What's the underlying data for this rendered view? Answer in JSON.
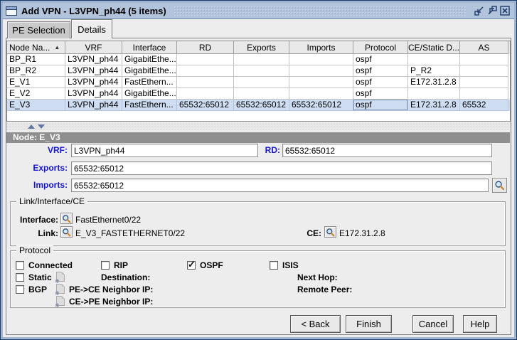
{
  "window": {
    "title": "Add VPN - L3VPN_ph44 (5 items)"
  },
  "tabs": {
    "pe_selection": "PE Selection",
    "details": "Details"
  },
  "table": {
    "headers": {
      "node": "Node Na...",
      "vrf": "VRF",
      "interface": "Interface",
      "rd": "RD",
      "exports": "Exports",
      "imports": "Imports",
      "protocol": "Protocol",
      "ce": "CE/Static D...",
      "as": "AS"
    },
    "sort_indicator": "▲",
    "rows": [
      {
        "node": "BP_R1",
        "vrf": "L3VPN_ph44",
        "interface": "GigabitEthe...",
        "rd": "",
        "exports": "",
        "imports": "",
        "protocol": "ospf",
        "ce": "",
        "as": ""
      },
      {
        "node": "BP_R2",
        "vrf": "L3VPN_ph44",
        "interface": "GigabitEthe...",
        "rd": "",
        "exports": "",
        "imports": "",
        "protocol": "ospf",
        "ce": "P_R2",
        "as": ""
      },
      {
        "node": "E_V1",
        "vrf": "L3VPN_ph44",
        "interface": "FastEthern...",
        "rd": "",
        "exports": "",
        "imports": "",
        "protocol": "ospf",
        "ce": "E172.31.2.8",
        "as": ""
      },
      {
        "node": "E_V2",
        "vrf": "L3VPN_ph44",
        "interface": "GigabitEthe...",
        "rd": "",
        "exports": "",
        "imports": "",
        "protocol": "ospf",
        "ce": "",
        "as": ""
      },
      {
        "node": "E_V3",
        "vrf": "L3VPN_ph44",
        "interface": "FastEthern...",
        "rd": "65532:65012",
        "exports": "65532:65012",
        "imports": "65532:65012",
        "protocol": "ospf",
        "ce": "E172.31.2.8",
        "as": "65532"
      }
    ]
  },
  "details": {
    "node_header": "Node: E_V3",
    "vrf": {
      "label": "VRF:",
      "value": "L3VPN_ph44"
    },
    "rd": {
      "label": "RD:",
      "value": "65532:65012"
    },
    "exports": {
      "label": "Exports:",
      "value": "65532:65012"
    },
    "imports": {
      "label": "Imports:",
      "value": "65532:65012"
    },
    "link_group": {
      "title": "Link/Interface/CE",
      "interface": {
        "label": "Interface:",
        "value": "FastEthernet0/22"
      },
      "link": {
        "label": "Link:",
        "value": "E_V3_FASTETHERNET0/22"
      },
      "ce": {
        "label": "CE:",
        "value": "E172.31.2.8"
      }
    },
    "protocol_group": {
      "title": "Protocol",
      "connected": {
        "label": "Connected",
        "checked": false
      },
      "rip": {
        "label": "RIP",
        "checked": false
      },
      "ospf": {
        "label": "OSPF",
        "checked": true
      },
      "isis": {
        "label": "ISIS",
        "checked": false
      },
      "static": {
        "label": "Static",
        "checked": false
      },
      "bgp": {
        "label": "BGP",
        "checked": false
      },
      "destination_label": "Destination:",
      "next_hop_label": "Next Hop:",
      "pe_ce_label": "PE->CE Neighbor IP:",
      "remote_peer_label": "Remote Peer:",
      "ce_pe_label": "CE->PE Neighbor IP:"
    }
  },
  "buttons": {
    "back": "< Back",
    "finish": "Finish",
    "cancel": "Cancel",
    "help": "Help"
  },
  "colors": {
    "titlebar": "#B2C3DC",
    "selection": "#CEDDF2",
    "label_blue": "#1616D1",
    "panel": "#EDEDED"
  }
}
